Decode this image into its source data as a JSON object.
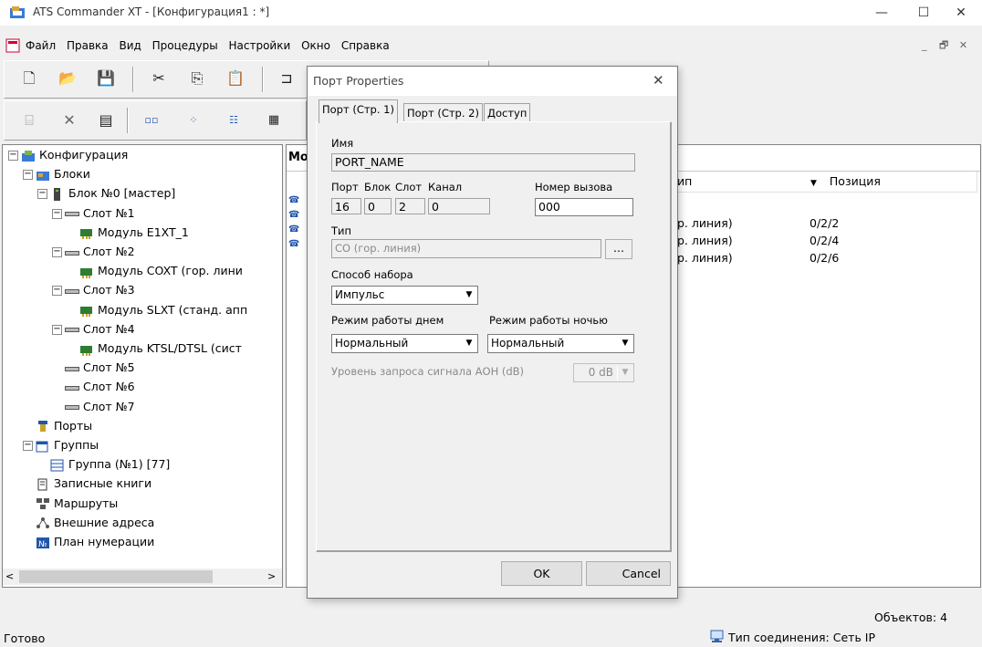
{
  "window": {
    "title": "ATS Commander XT - [Конфигурация1 : *]",
    "minimize": "—",
    "maximize": "☐",
    "close": "✕",
    "mdi_buttons": [
      "_",
      "🗗",
      "✕"
    ]
  },
  "menu": [
    "Файл",
    "Правка",
    "Вид",
    "Процедуры",
    "Настройки",
    "Окно",
    "Справка"
  ],
  "tree": {
    "items": [
      {
        "label": "Конфигурация",
        "icon": "config-icon"
      },
      {
        "label": "Блоки",
        "icon": "blocks-icon"
      },
      {
        "label": "Блок №0 [мастер]",
        "icon": "block-icon"
      },
      {
        "label": "Слот №1",
        "icon": "slot-icon"
      },
      {
        "label": "Модуль E1XT_1",
        "icon": "module-icon"
      },
      {
        "label": "Слот №2",
        "icon": "slot-icon"
      },
      {
        "label": "Модуль COXT (гор. лини",
        "icon": "module-icon"
      },
      {
        "label": "Слот №3",
        "icon": "slot-icon"
      },
      {
        "label": "Модуль SLXT (станд. апп",
        "icon": "module-icon"
      },
      {
        "label": "Слот №4",
        "icon": "slot-icon"
      },
      {
        "label": "Модуль KTSL/DTSL (сист",
        "icon": "module-icon"
      },
      {
        "label": "Слот №5",
        "icon": "slot-icon"
      },
      {
        "label": "Слот №6",
        "icon": "slot-icon"
      },
      {
        "label": "Слот №7",
        "icon": "slot-icon"
      },
      {
        "label": "Порты",
        "icon": "ports-icon"
      },
      {
        "label": "Группы",
        "icon": "groups-icon"
      },
      {
        "label": "Группа (№1) [77]",
        "icon": "group-icon"
      },
      {
        "label": "Записные книги",
        "icon": "book-icon"
      },
      {
        "label": "Маршруты",
        "icon": "routes-icon"
      },
      {
        "label": "Внешние адреса",
        "icon": "addresses-icon"
      },
      {
        "label": "План нумерации",
        "icon": "numbering-icon"
      }
    ]
  },
  "list": {
    "header_left": "Мо",
    "columns": [
      "ип",
      "Позиция"
    ],
    "rows": [
      {
        "type": "р. линия)",
        "position": "0/2/2"
      },
      {
        "type": "р. линия)",
        "position": "0/2/4"
      },
      {
        "type": "р. линия)",
        "position": "0/2/6"
      }
    ]
  },
  "dialog": {
    "title": "Порт Properties",
    "tabs": [
      "Порт (Стр. 1)",
      "Порт (Стр. 2)",
      "Доступ"
    ],
    "name_label": "Имя",
    "name_value": "PORT_NAME",
    "port_label": "Порт",
    "port_value": "16",
    "block_label": "Блок",
    "block_value": "0",
    "slot_label": "Слот",
    "slot_value": "2",
    "channel_label": "Канал",
    "channel_value": "0",
    "call_number_label": "Номер вызова",
    "call_number_value": "000",
    "type_label": "Тип",
    "type_value": "CO (гор. линия)",
    "browse": "...",
    "dial_label": "Способ набора",
    "dial_value": "Импульс",
    "day_label": "Режим работы днем",
    "day_value": "Нормальный",
    "night_label": "Режим работы ночью",
    "night_value": "Нормальный",
    "aon_label": "Уровень запроса сигнала АОН (dB)",
    "aon_value": "0  dB",
    "ok": "OK",
    "cancel": "Cancel"
  },
  "status": {
    "ready": "Готово",
    "objects": "Объектов: 4",
    "connection": "Тип соединения: Сеть IP"
  }
}
